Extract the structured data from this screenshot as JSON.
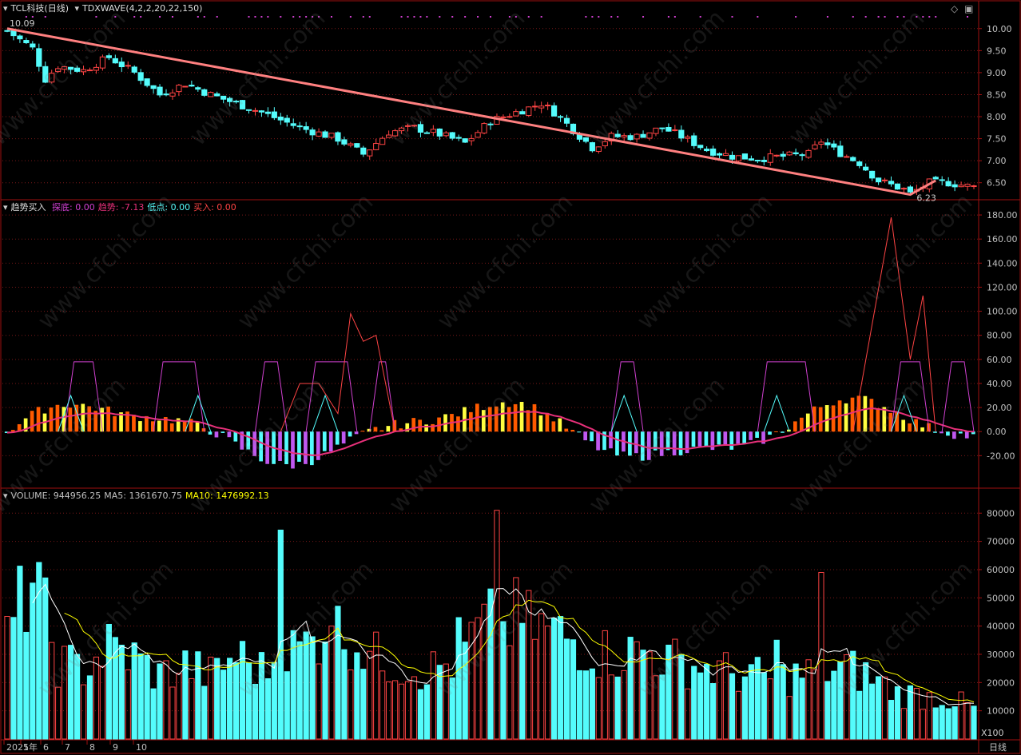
{
  "colors": {
    "up": "#ff4444",
    "down": "#54fcfc",
    "frame": "#a01010",
    "axis_text": "#c0c0c0",
    "trendline": "#ff8080",
    "ma5": "#ffffff",
    "ma10": "#ffff00",
    "magenta": "#d040d0",
    "pink": "#e8307a",
    "cyan": "#54fcfc",
    "orange": "#ff5a00",
    "yellow": "#ffff40",
    "purple": "#c058f0"
  },
  "panel_price": {
    "stock": "TCL科技",
    "period": "(日线)",
    "indicator": "TDXWAVE(4,2,2,20,22,150)",
    "high_label": "10.09",
    "low_label": "6.23"
  },
  "panel_trend": {
    "title": "趋势买入",
    "items": [
      {
        "label": "探底:",
        "value": "0.00",
        "color": "#d040d0"
      },
      {
        "label": "趋势:",
        "value": "-7.13",
        "color": "#e8307a"
      },
      {
        "label": "低点:",
        "value": "0.00",
        "color": "#54fcfc"
      },
      {
        "label": "买入:",
        "value": "0.00",
        "color": "#ff4444"
      }
    ]
  },
  "panel_volume": {
    "items": [
      {
        "label": "VOLUME:",
        "value": "944956.25",
        "color": "#c0c0c0"
      },
      {
        "label": "MA5:",
        "value": "1361670.75",
        "color": "#c0c0c0"
      },
      {
        "label": "MA10:",
        "value": "1476992.13",
        "color": "#ffff00"
      }
    ],
    "unit": "X100"
  },
  "x_axis": {
    "labels": [
      "2021年",
      "5",
      "6",
      "7",
      "8",
      "9",
      "10"
    ],
    "period": "日线"
  },
  "watermark": "www.cfchi.com",
  "chart_data": [
    {
      "type": "candlestick",
      "title": "TDXWAVE(4,2,2,20,22,150)",
      "ylim": [
        6.15,
        10.25
      ],
      "yticks": [
        6.5,
        7.0,
        7.5,
        8.0,
        8.5,
        9.0,
        9.5,
        10.0
      ],
      "close_start": 9.95,
      "close_waypoints": [
        [
          0,
          9.95
        ],
        [
          4,
          9.55
        ],
        [
          6,
          8.85
        ],
        [
          8,
          9.15
        ],
        [
          12,
          9.05
        ],
        [
          16,
          9.35
        ],
        [
          20,
          9.0
        ],
        [
          24,
          8.5
        ],
        [
          28,
          8.75
        ],
        [
          32,
          8.5
        ],
        [
          36,
          8.3
        ],
        [
          40,
          8.1
        ],
        [
          46,
          7.75
        ],
        [
          52,
          7.5
        ],
        [
          56,
          7.15
        ],
        [
          60,
          7.65
        ],
        [
          64,
          7.75
        ],
        [
          68,
          7.6
        ],
        [
          72,
          7.4
        ],
        [
          76,
          7.9
        ],
        [
          80,
          8.1
        ],
        [
          84,
          8.3
        ],
        [
          86,
          8.1
        ],
        [
          89,
          7.7
        ],
        [
          92,
          7.3
        ],
        [
          95,
          7.55
        ],
        [
          99,
          7.55
        ],
        [
          103,
          7.75
        ],
        [
          106,
          7.55
        ],
        [
          110,
          7.25
        ],
        [
          114,
          7.1
        ],
        [
          118,
          7.05
        ],
        [
          122,
          7.1
        ],
        [
          126,
          7.15
        ],
        [
          128,
          7.45
        ],
        [
          130,
          7.25
        ],
        [
          134,
          6.95
        ],
        [
          137,
          6.55
        ],
        [
          141,
          6.35
        ],
        [
          142,
          6.25
        ],
        [
          145,
          6.5
        ],
        [
          148,
          6.5
        ],
        [
          152,
          6.4
        ]
      ],
      "trendline": [
        [
          0,
          10.0
        ],
        [
          142,
          6.23
        ],
        [
          146,
          6.55
        ]
      ],
      "markers": {
        "high": 10.09,
        "low": 6.23
      }
    },
    {
      "type": "bar",
      "title": "趋势买入",
      "ylim": [
        -45,
        190
      ],
      "yticks": [
        -20,
        0,
        20,
        40,
        60,
        80,
        100,
        120,
        140,
        160,
        180
      ],
      "series": [
        {
          "name": "探底",
          "values": [
            0.0
          ]
        },
        {
          "name": "趋势",
          "values": [
            -7.13
          ]
        },
        {
          "name": "低点",
          "values": [
            0.0
          ]
        },
        {
          "name": "买入",
          "values": [
            0.0
          ]
        }
      ]
    },
    {
      "type": "bar",
      "title": "VOLUME",
      "ylim": [
        0,
        88000
      ],
      "yticks": [
        10000,
        20000,
        30000,
        40000,
        50000,
        60000,
        70000,
        80000
      ],
      "series": [
        {
          "name": "VOLUME",
          "values": [
            944956.25
          ]
        },
        {
          "name": "MA5",
          "values": [
            1361670.75
          ]
        },
        {
          "name": "MA10",
          "values": [
            1476992.13
          ]
        }
      ],
      "volume_waypoints": [
        [
          0,
          40000
        ],
        [
          2,
          52000
        ],
        [
          4,
          62000
        ],
        [
          6,
          48000
        ],
        [
          8,
          30000
        ],
        [
          12,
          28000
        ],
        [
          16,
          36000
        ],
        [
          20,
          32000
        ],
        [
          24,
          25000
        ],
        [
          28,
          29000
        ],
        [
          32,
          25000
        ],
        [
          36,
          33000
        ],
        [
          40,
          27000
        ],
        [
          44,
          34000
        ],
        [
          48,
          38000
        ],
        [
          50,
          45000
        ],
        [
          54,
          40000
        ],
        [
          58,
          32000
        ],
        [
          62,
          29000
        ],
        [
          66,
          27000
        ],
        [
          70,
          30000
        ],
        [
          72,
          36000
        ],
        [
          74,
          42000
        ],
        [
          76,
          45000
        ],
        [
          78,
          42000
        ],
        [
          80,
          48000
        ],
        [
          82,
          45000
        ],
        [
          86,
          42000
        ],
        [
          88,
          40000
        ],
        [
          92,
          35000
        ],
        [
          96,
          33000
        ],
        [
          100,
          35000
        ],
        [
          104,
          31000
        ],
        [
          108,
          29000
        ],
        [
          112,
          27000
        ],
        [
          116,
          25000
        ],
        [
          120,
          24000
        ],
        [
          124,
          25000
        ],
        [
          128,
          27000
        ],
        [
          132,
          28000
        ],
        [
          136,
          24000
        ],
        [
          140,
          18000
        ],
        [
          144,
          17000
        ],
        [
          148,
          16000
        ],
        [
          152,
          12000
        ]
      ],
      "spikes": [
        [
          43,
          74000
        ],
        [
          51,
          40000
        ],
        [
          77,
          81000
        ],
        [
          71,
          43000
        ],
        [
          128,
          59000
        ],
        [
          121,
          35000
        ]
      ]
    }
  ]
}
